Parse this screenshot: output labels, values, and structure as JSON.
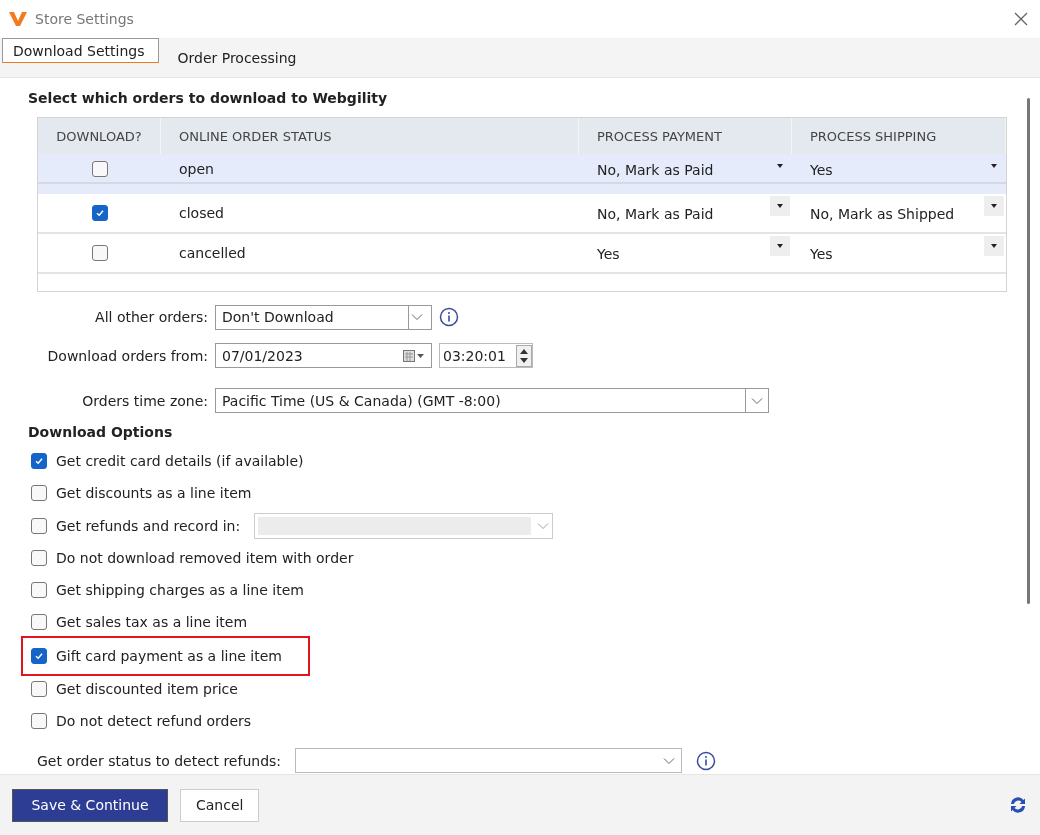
{
  "window": {
    "title": "Store Settings"
  },
  "tabs": [
    {
      "label": "Download Settings",
      "selected": true
    },
    {
      "label": "Order Processing",
      "selected": false
    }
  ],
  "orders_section": {
    "heading": "Select which orders to download to Webgility",
    "columns": [
      "DOWNLOAD?",
      "ONLINE ORDER STATUS",
      "PROCESS PAYMENT",
      "PROCESS SHIPPING"
    ],
    "rows": [
      {
        "checked": false,
        "selected": true,
        "status": "open",
        "payment": "No, Mark as Paid",
        "shipping": "Yes"
      },
      {
        "checked": true,
        "selected": false,
        "status": "closed",
        "payment": "No, Mark as Paid",
        "shipping": "No, Mark as Shipped"
      },
      {
        "checked": false,
        "selected": false,
        "status": "cancelled",
        "payment": "Yes",
        "shipping": "Yes"
      }
    ]
  },
  "fields": [
    {
      "kind": "select",
      "label": "All other orders:",
      "value": "Don't Download"
    },
    {
      "kind": "datetime",
      "label": "Download orders from:",
      "value": "07/01/2023",
      "time": "03:20:01"
    },
    {
      "kind": "wide-select",
      "label": "Orders time zone:",
      "value": "Pacific Time (US & Canada) (GMT -8:00)"
    }
  ],
  "download_options": {
    "heading": "Download Options",
    "options": [
      {
        "kind": "checkbox",
        "label": "Get credit card details (if available)",
        "checked": true,
        "highlighted": false
      },
      {
        "kind": "checkbox",
        "label": "Get discounts as a line item",
        "checked": false,
        "highlighted": false
      },
      {
        "kind": "checkbox-select",
        "label": "Get refunds and record in:",
        "checked": false,
        "highlighted": false,
        "disabled": true
      },
      {
        "kind": "checkbox",
        "label": "Do not download removed item with order",
        "checked": false,
        "highlighted": false
      },
      {
        "kind": "checkbox",
        "label": "Get shipping charges as a line item",
        "checked": false,
        "highlighted": false
      },
      {
        "kind": "checkbox",
        "label": "Get sales tax as a line item",
        "checked": false,
        "highlighted": false
      },
      {
        "kind": "checkbox",
        "label": "Gift card payment as a line item",
        "checked": true,
        "highlighted": true
      },
      {
        "kind": "checkbox",
        "label": "Get discounted item price",
        "checked": false,
        "highlighted": false
      },
      {
        "kind": "checkbox",
        "label": "Do not detect refund orders",
        "checked": false,
        "highlighted": false
      }
    ],
    "refund_status": {
      "label": "Get order status to detect refunds:"
    }
  },
  "buttons": [
    {
      "label": "Save & Continue",
      "kind": "primary"
    },
    {
      "label": "Cancel",
      "kind": "secondary"
    }
  ]
}
